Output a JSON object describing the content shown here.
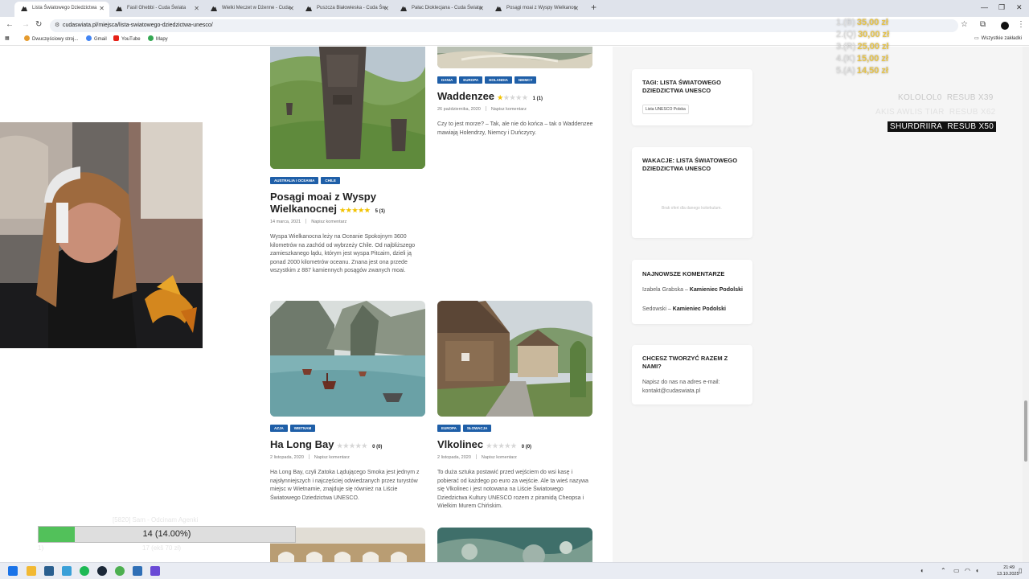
{
  "browser": {
    "tabs": [
      {
        "label": "Lista Światowego Dziedzictwa"
      },
      {
        "label": "Fasil Ghebbi - Cuda Świata"
      },
      {
        "label": "Wielki Meczet w Dżenne - Cuda"
      },
      {
        "label": "Puszcza Białowieska - Cuda Św"
      },
      {
        "label": "Pałac Dioklecjana - Cuda Świata"
      },
      {
        "label": "Posągi moai z Wyspy Wielkanoc"
      }
    ],
    "new_tab_glyph": "+",
    "url": "cudaswiata.pl/miejsca/lista-swiatowego-dziedzictwa-unesco/",
    "bookmarks": [
      "Dwuczęściowy stroj...",
      "Gmail",
      "YouTube",
      "Mapy"
    ],
    "all_bookmarks": "Wszystkie zakładki"
  },
  "articles": [
    {
      "tags": [
        "Australia i Oceania",
        "Chile"
      ],
      "title": "Posągi moai z Wyspy Wielkanocnej",
      "stars": "★★★★★",
      "empty_stars": "",
      "rating": "5 (1)",
      "date": "14 marca, 2021",
      "comment": "Napisz komentarz",
      "excerpt": "Wyspa Wielkanocna leży na Oceanie Spokojnym 3600 kilometrów na zachód od wybrzeży Chile. Od najbliższego zamieszkanego lądu, którym jest wyspa Pitcairn, dzieli ją ponad 2000 kilometrów oceanu. Znana jest ona przede wszystkim z 887 kamiennych posągów zwanych moai."
    },
    {
      "tags": [
        "Dania",
        "Europa",
        "Holandia",
        "Niemcy"
      ],
      "title": "Waddenzee",
      "stars": "★",
      "empty_stars": "★★★★",
      "rating": "1 (1)",
      "date": "26 października, 2020",
      "comment": "Napisz komentarz",
      "excerpt": "Czy to jest morze? – Tak, ale nie do końca – tak o Waddenzee mawiają Holendrzy, Niemcy i Duńczycy."
    },
    {
      "tags": [
        "Azja",
        "Wietnam"
      ],
      "title": "Ha Long Bay",
      "stars": "",
      "empty_stars": "★★★★★",
      "rating": "0 (0)",
      "date": "2 listopada, 2020",
      "comment": "Napisz komentarz",
      "excerpt": "Ha Long Bay, czyli Zatoka Lądującego Smoka jest jednym z najsłynniejszych i najczęściej odwiedzanych przez turystów miejsc w Wietnamie, znajduje się również na Liście Światowego Dziedzictwa UNESCO."
    },
    {
      "tags": [
        "Europa",
        "Słowacja"
      ],
      "title": "Vlkolinec",
      "stars": "",
      "empty_stars": "★★★★★",
      "rating": "0 (0)",
      "date": "2 listopada, 2020",
      "comment": "Napisz komentarz",
      "excerpt": "To duża sztuka postawić przed wejściem do wsi kasę i pobierać od każdego po euro za wejście. Ale ta wieś nazywa się Vlkolinec i jest notowana na Liście Światowego Dziedzictwa Kultury UNESCO rozem z piramidą Cheopsa i Wielkim Murem Chińskim."
    }
  ],
  "sidebar": {
    "tags_title": "Tagi: Lista Światowego Dziedzictwa UNESCO",
    "tags_chip": "Lista UNESCO Polska",
    "vacation_title": "Wakacje: Lista Światowego Dziedzictwa UNESCO",
    "vacation_note": "Brak ofert dla danego kolorkulum.",
    "comments_title": "Najnowsze komentarze",
    "comments": [
      {
        "author": "Izabela Grabska",
        "sep": "–",
        "post": "Kamieniec Podolski"
      },
      {
        "author": "Sedowski",
        "sep": "–",
        "post": "Kamieniec Podolski"
      }
    ],
    "contact_title": "Chcesz tworzyć razem z nami?",
    "contact_text": "Napisz do nas na adres e-mail: kontakt@cudaswiata.pl"
  },
  "overlay": {
    "donations": [
      {
        "pos": "1.(B)",
        "amount": "35,00 zł"
      },
      {
        "pos": "2.(Q)",
        "amount": "30,00 zł"
      },
      {
        "pos": "3.(R)",
        "amount": "25,00 zł"
      },
      {
        "pos": "4.(K)",
        "amount": "15,00 zł"
      },
      {
        "pos": "5.(A)",
        "amount": "14,50 zł"
      }
    ],
    "subs": [
      {
        "name": "KOLOLOL0",
        "label": "RESUB X39"
      },
      {
        "name": "AKIS AWLIS TIAR",
        "label": "RESUB X62"
      },
      {
        "name": "SHURDRIIRA",
        "label": "RESUB X50"
      }
    ],
    "ghost_top": "[5820] Sam - Odcinam Agenki",
    "ghost_bottom_left": "1)",
    "ghost_bottom_mid": "17 (ekš 70 zł)",
    "progress": {
      "label": "14 (14.00%)",
      "fraction": 0.14
    }
  },
  "taskbar": {
    "time": "21:49",
    "date": "13.10.2025"
  },
  "colors": {
    "tag_bg": "#1f5fa8",
    "star": "#f2c200",
    "progress_fill": "#52c15a",
    "donation": "#e6c34a"
  }
}
